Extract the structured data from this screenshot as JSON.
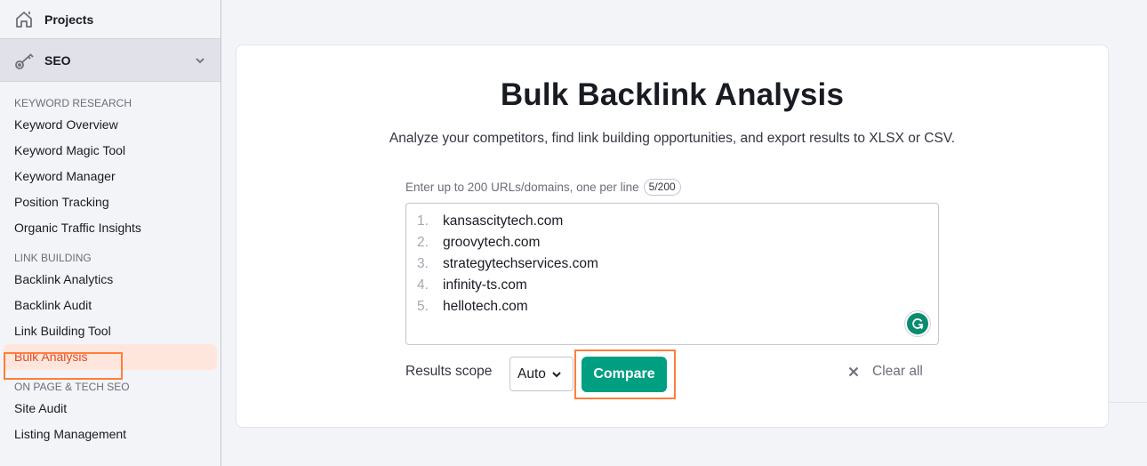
{
  "sidebar": {
    "projects_label": "Projects",
    "projects_icon": "home-icon",
    "seo_label": "SEO",
    "seo_icon": "key-icon",
    "sections": [
      {
        "title": "KEYWORD RESEARCH",
        "items": [
          {
            "label": "Keyword Overview"
          },
          {
            "label": "Keyword Magic Tool"
          },
          {
            "label": "Keyword Manager"
          },
          {
            "label": "Position Tracking"
          },
          {
            "label": "Organic Traffic Insights"
          }
        ]
      },
      {
        "title": "LINK BUILDING",
        "items": [
          {
            "label": "Backlink Analytics"
          },
          {
            "label": "Backlink Audit"
          },
          {
            "label": "Link Building Tool"
          },
          {
            "label": "Bulk Analysis",
            "active": true
          }
        ]
      },
      {
        "title": "ON PAGE & TECH SEO",
        "items": [
          {
            "label": "Site Audit"
          },
          {
            "label": "Listing Management"
          }
        ]
      }
    ]
  },
  "main": {
    "title": "Bulk Backlink Analysis",
    "subtitle": "Analyze your competitors, find link building opportunities, and export results to XLSX or CSV.",
    "field_label": "Enter up to 200 URLs/domains, one per line",
    "counter": "5/200",
    "urls": [
      {
        "num": "1.",
        "value": "kansascitytech.com"
      },
      {
        "num": "2.",
        "value": "groovytech.com"
      },
      {
        "num": "3.",
        "value": "strategytechservices.com"
      },
      {
        "num": "4.",
        "value": "infinity-ts.com"
      },
      {
        "num": "5.",
        "value": "hellotech.com"
      }
    ],
    "scope_label": "Results scope",
    "scope_value": "Auto",
    "compare_label": "Compare",
    "clear_label": "Clear all"
  },
  "colors": {
    "accent_green": "#009f81",
    "highlight_orange": "#ff7e3c",
    "active_text": "#e04a1f",
    "active_bg": "#ffe6dd"
  }
}
